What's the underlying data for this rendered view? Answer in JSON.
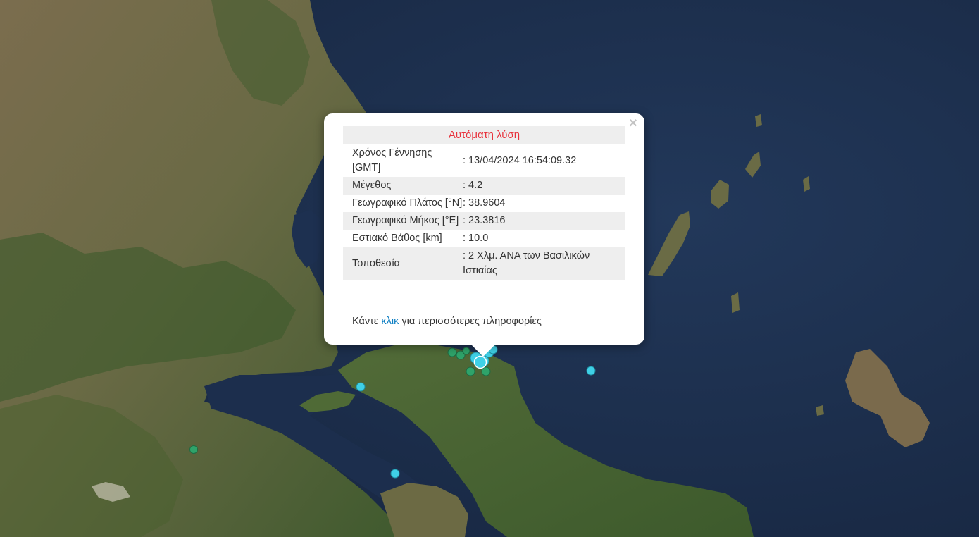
{
  "colors": {
    "sea": "#1b2c47",
    "land": "#5a6a38",
    "title_text": "#e8323c",
    "link": "#0a7dc2",
    "marker_recent": "#3fd0e6",
    "marker_older": "#2fa36a"
  },
  "popup": {
    "title": "Αυτόματη λύση",
    "close_icon": "close-icon",
    "rows": [
      {
        "label": "Χρόνος Γέννησης [GMT]",
        "value": ": 13/04/2024 16:54:09.32"
      },
      {
        "label": "Μέγεθος",
        "value": ": 4.2"
      },
      {
        "label": "Γεωγραφικό Πλάτος [°N]",
        "value": ": 38.9604"
      },
      {
        "label": "Γεωγραφικό Μήκος [°E]",
        "value": ": 23.3816"
      },
      {
        "label": "Εστιακό Βάθος [km]",
        "value": ": 10.0"
      },
      {
        "label": "Τοποθεσία",
        "value": ": 2 Χλμ. ΑΝΑ των Βασιλικών Ιστιαίας"
      }
    ],
    "more": {
      "prefix": "Κάντε ",
      "link": "κλικ",
      "suffix": " για περισσότερες πληροφορίες"
    }
  }
}
